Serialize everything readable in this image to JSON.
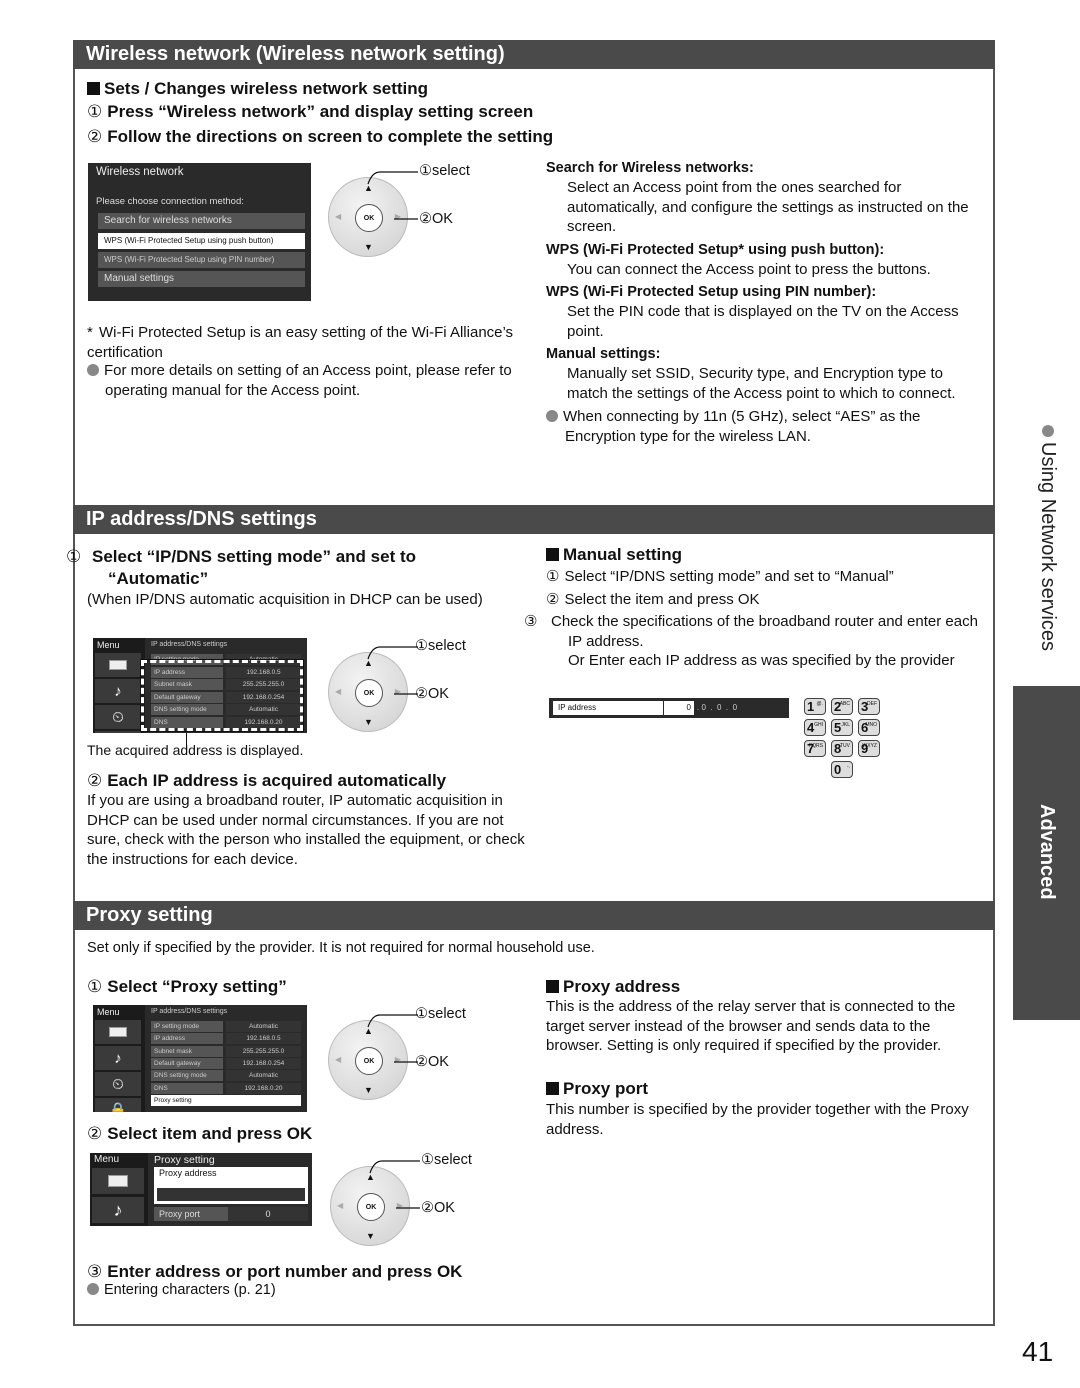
{
  "page_number": "41",
  "side": {
    "section": "Using Network services",
    "tab": "Advanced"
  },
  "wireless": {
    "title": "Wireless network (Wireless network setting)",
    "heading": "Sets / Changes wireless network setting",
    "step1": "Press “Wireless network” and display setting screen",
    "step2": "Follow the directions on screen to complete the setting",
    "screen": {
      "title": "Wireless network",
      "prompt": "Please choose connection method:",
      "options": [
        "Search for wireless networks",
        "WPS (Wi-Fi Protected Setup using push button)",
        "WPS (Wi-Fi Protected Setup using PIN number)",
        "Manual settings"
      ]
    },
    "dial": {
      "select": "select",
      "ok": "OK",
      "ok_key": "OK"
    },
    "footnote": "Wi-Fi Protected Setup is an easy setting of the Wi-Fi Alliance’s certification",
    "note": "For more details on setting of an Access point, please refer to operating manual for the Access point.",
    "descriptions": [
      {
        "term": "Search for Wireless networks:",
        "text": "Select an Access point from the ones searched for automatically, and configure the settings as instructed on the screen."
      },
      {
        "term": "WPS (Wi-Fi Protected Setup* using push button):",
        "text": "You can connect the Access point to press the buttons."
      },
      {
        "term": "WPS (Wi-Fi Protected Setup using PIN number):",
        "text": "Set the PIN code that is displayed on the TV on the Access point."
      },
      {
        "term": "Manual settings:",
        "text": "Manually set SSID, Security type, and Encryption type to match the settings of the Access point to which to connect."
      }
    ],
    "note_11n": "When connecting by 11n (5 GHz), select “AES” as the Encryption type for the wireless LAN."
  },
  "ipdns": {
    "title": "IP address/DNS settings",
    "step1": "Select “IP/DNS setting mode” and set to “Automatic”",
    "step1_note": "(When IP/DNS automatic acquisition in DHCP can be used)",
    "caption": "The acquired address is displayed.",
    "step2": "Each IP address is acquired automatically",
    "step2_text": "If you are using a broadband router, IP automatic acquisition in DHCP can be used under normal circumstances. If you are not sure, check with the person who installed the equipment, or check the instructions for each device.",
    "screen": {
      "menu": "Menu",
      "title": "IP address/DNS settings",
      "rows": [
        {
          "k": "IP setting mode",
          "v": "Automatic"
        },
        {
          "k": "IP address",
          "v": "192.168.0.5"
        },
        {
          "k": "Subnet mask",
          "v": "255.255.255.0"
        },
        {
          "k": "Default gateway",
          "v": "192.168.0.254"
        },
        {
          "k": "DNS setting mode",
          "v": "Automatic"
        },
        {
          "k": "DNS",
          "v": "192.168.0.20"
        }
      ],
      "proxy_row": "Proxy setting"
    },
    "manual": {
      "heading": "Manual setting",
      "steps": [
        "Select “IP/DNS setting mode” and set to “Manual”",
        "Select the item and press OK",
        "Check the specifications of the broadband router and enter each IP address."
      ],
      "step3_extra": "Or Enter each IP address as was specified by the provider",
      "ip_field": {
        "label": "IP address",
        "octets": [
          "0",
          "0",
          "0",
          "0"
        ]
      },
      "keypad": [
        {
          "n": "1",
          "s": "@."
        },
        {
          "n": "2",
          "s": "ABC"
        },
        {
          "n": "3",
          "s": "DEF"
        },
        {
          "n": "4",
          "s": "GHI"
        },
        {
          "n": "5",
          "s": "JKL"
        },
        {
          "n": "6",
          "s": "MNO"
        },
        {
          "n": "7",
          "s": "PQRS"
        },
        {
          "n": "8",
          "s": "TUV"
        },
        {
          "n": "9",
          "s": "WXYZ"
        },
        {
          "n": "0",
          "s": "-."
        }
      ]
    }
  },
  "proxy": {
    "title": "Proxy setting",
    "intro": "Set only if specified by the provider. It is not required for normal household use.",
    "step1": "Select “Proxy setting”",
    "step2": "Select item and press OK",
    "step3": "Enter address or port number and press OK",
    "step3_note": "Entering characters (p. 21)",
    "screen2": {
      "menu": "Menu",
      "title": "Proxy setting",
      "address_label": "Proxy address",
      "address_value": "",
      "port_label": "Proxy port",
      "port_value": "0"
    },
    "address_heading": "Proxy address",
    "address_text": "This is the address of the relay server that is connected to the target server instead of the browser and sends data to the browser. Setting is only required if specified by the provider.",
    "port_heading": "Proxy port",
    "port_text": "This number is specified by the provider together with the Proxy address."
  }
}
